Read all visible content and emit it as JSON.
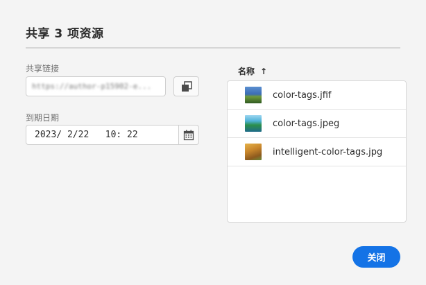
{
  "dialog": {
    "title": "共享 3 项资源",
    "share_link_label": "共享链接",
    "share_link_value": "https://author-p15902-e...",
    "expiry_label": "到期日期",
    "expiry_value": "2023/ 2/22   10: 22",
    "close_label": "关闭"
  },
  "assets": {
    "column_header": "名称",
    "sort_icon": "arrow-up-icon",
    "items": [
      {
        "name": "color-tags.jfif",
        "thumb_icon": "image-thumbnail"
      },
      {
        "name": "color-tags.jpeg",
        "thumb_icon": "image-thumbnail"
      },
      {
        "name": "intelligent-color-tags.jpg",
        "thumb_icon": "image-thumbnail"
      }
    ]
  },
  "colors": {
    "accent": "#1473e6",
    "background": "#f4f4f4"
  }
}
